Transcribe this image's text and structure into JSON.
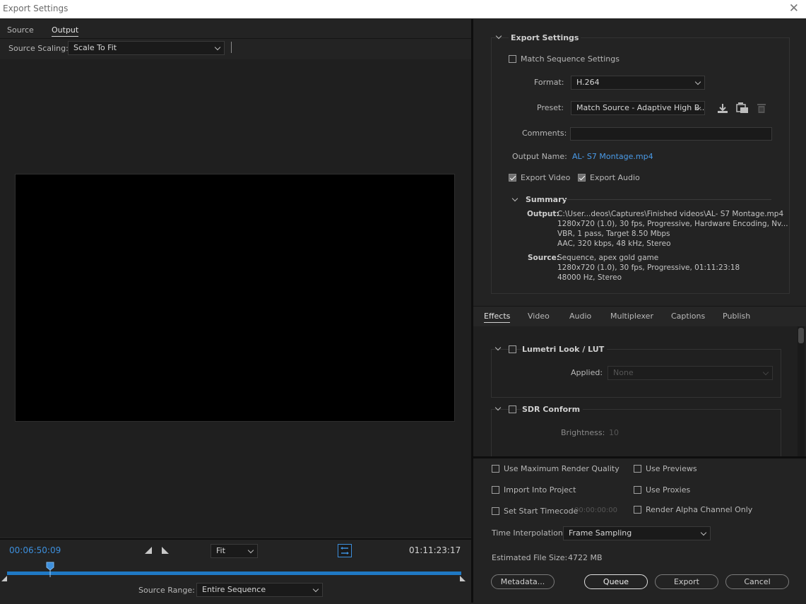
{
  "window": {
    "title": "Export Settings",
    "close_glyph": "✕"
  },
  "left": {
    "tabs": {
      "source": "Source",
      "output": "Output"
    },
    "source_scaling": {
      "label": "Source Scaling:",
      "value": "Scale To Fit"
    },
    "timeline": {
      "current_time": "00:06:50:09",
      "fit_value": "Fit",
      "duration": "01:11:23:17",
      "playhead_fraction": 0.095,
      "source_range_label": "Source Range:",
      "source_range_value": "Entire Sequence"
    }
  },
  "right": {
    "export_settings": {
      "heading": "Export Settings",
      "match_sequence_label": "Match Sequence Settings",
      "match_sequence_checked": false,
      "format_label": "Format:",
      "format_value": "H.264",
      "preset_label": "Preset:",
      "preset_value": "Match Source - Adaptive High B...",
      "comments_label": "Comments:",
      "comments_value": "",
      "output_name_label": "Output Name:",
      "output_name_value": "AL- S7 Montage.mp4",
      "export_video_label": "Export Video",
      "export_video_checked": true,
      "export_audio_label": "Export Audio",
      "export_audio_checked": true
    },
    "summary": {
      "heading": "Summary",
      "output_label": "Output:",
      "output_lines": [
        "C:\\User...deos\\Captures\\Finished videos\\AL- S7 Montage.mp4",
        "1280x720 (1.0), 30 fps, Progressive, Hardware Encoding, Nv...",
        "VBR, 1 pass, Target 8.50 Mbps",
        "AAC, 320 kbps, 48 kHz, Stereo"
      ],
      "source_label": "Source:",
      "source_lines": [
        "Sequence, apex gold game",
        "1280x720 (1.0), 30 fps, Progressive, 01:11:23:18",
        "48000 Hz, Stereo"
      ]
    },
    "tabs": {
      "effects": "Effects",
      "video": "Video",
      "audio": "Audio",
      "multiplexer": "Multiplexer",
      "captions": "Captions",
      "publish": "Publish"
    },
    "effects": {
      "lumetri_label": "Lumetri Look / LUT",
      "lumetri_applied_label": "Applied:",
      "lumetri_applied_value": "None",
      "sdr_label": "SDR Conform",
      "sdr_brightness_label": "Brightness:",
      "sdr_brightness_value": "10"
    },
    "options": {
      "max_render_quality": "Use Maximum Render Quality",
      "use_previews": "Use Previews",
      "import_into_project": "Import Into Project",
      "use_proxies": "Use Proxies",
      "set_start_timecode": "Set Start Timecode",
      "start_timecode_value": "00:00:00:00",
      "render_alpha": "Render Alpha Channel Only",
      "time_interpolation_label": "Time Interpolation:",
      "time_interpolation_value": "Frame Sampling",
      "estimated_size_label": "Estimated File Size:",
      "estimated_size_value": "4722 MB"
    },
    "buttons": {
      "metadata": "Metadata...",
      "queue": "Queue",
      "export": "Export",
      "cancel": "Cancel"
    }
  },
  "colors": {
    "accent": "#3d8fdc",
    "link": "#4a9be8",
    "background": "#232323"
  },
  "icons": [
    "close-icon",
    "chevron-down-icon",
    "save-preset-icon",
    "import-preset-icon",
    "delete-preset-icon",
    "mark-in-icon",
    "mark-out-icon",
    "safe-margins-icon",
    "playhead-icon"
  ]
}
